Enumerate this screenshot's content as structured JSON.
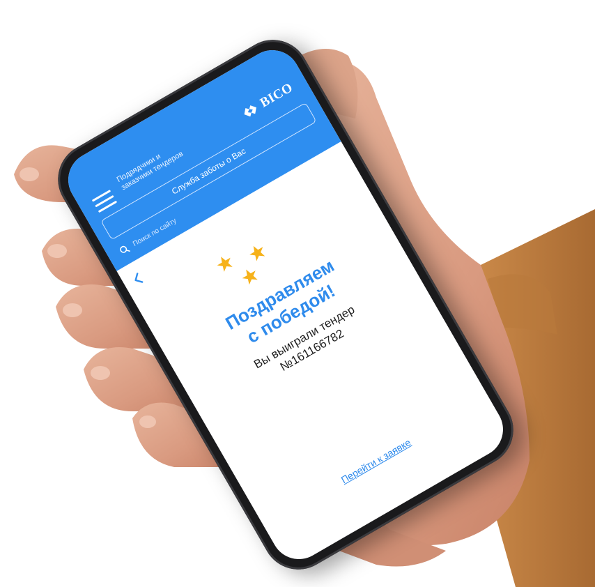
{
  "header": {
    "brand_line1": "Подрядчики и",
    "brand_line2": "заказчики тендеров",
    "logo_text": "BICO",
    "service_field": "Служба заботы о Вас",
    "search_placeholder": "Поиск по сайту"
  },
  "content": {
    "congrats_line1": "Поздравляем",
    "congrats_line2": "с победой!",
    "won_line1": "Вы выиграли тендер",
    "tender_number": "№161166782",
    "go_link": "Перейти к заявке"
  },
  "icons": {
    "menu": "menu-icon",
    "logo": "logo-icon",
    "search": "search-icon",
    "back": "back-icon",
    "star": "star-icon"
  },
  "colors": {
    "accent": "#2e8ef0",
    "star": "#f6b21a",
    "text": "#1f1f1f"
  }
}
